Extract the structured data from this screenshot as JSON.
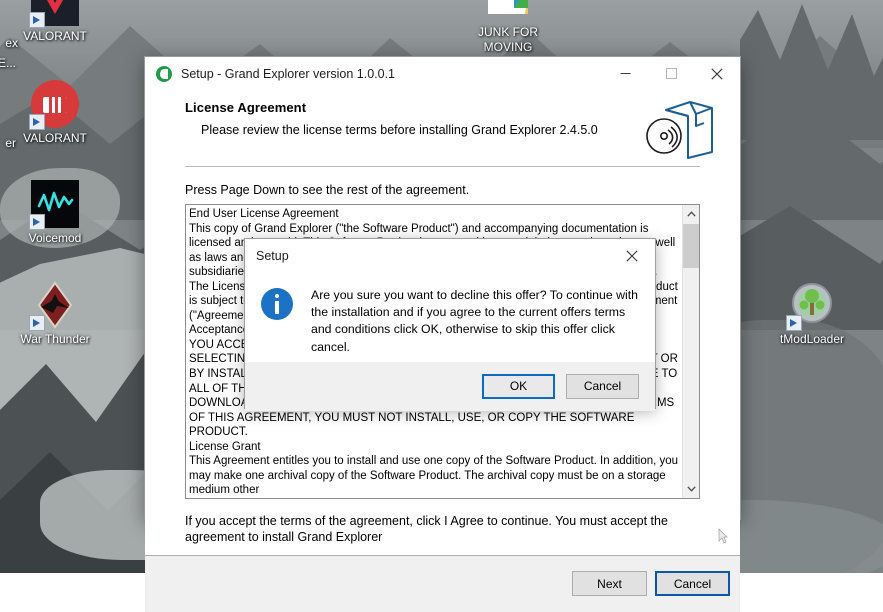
{
  "desktop": {
    "icons": [
      {
        "label": "VALORANT",
        "icon": "valorant-tile-icon",
        "shortcut": true
      },
      {
        "label": "VALORANT",
        "icon": "riot-fist-icon",
        "shortcut": true
      },
      {
        "label": "Voicemod",
        "icon": "voicemod-icon",
        "shortcut": true
      },
      {
        "label": "War Thunder",
        "icon": "war-thunder-icon",
        "shortcut": true
      },
      {
        "label": "JUNK FOR MOVING",
        "icon": "folder-icon",
        "shortcut": false
      },
      {
        "label": "tModLoader",
        "icon": "tmodloader-icon",
        "shortcut": true
      }
    ],
    "partial_labels": {
      "left_top": "ex",
      "left_top2": "E...",
      "left_mid": "er"
    }
  },
  "setup_window": {
    "title": "Setup - Grand Explorer version 1.0.0.1",
    "app_icon": "grand-explorer-icon",
    "window_controls": {
      "minimize": "minimize-icon",
      "maximize": "maximize-icon",
      "close": "close-icon"
    },
    "hero": {
      "heading": "License Agreement",
      "subheading": "Please review the license terms before installing Grand Explorer 2.4.5.0",
      "art": "software-box-cd-icon"
    },
    "page_down_hint": "Press Page Down to see the rest of the agreement.",
    "license_text": "End User License Agreement\nThis copy of Grand Explorer (\"the Software Product\") and accompanying documentation is licensed and not sold. This Software Product is protected by copyright laws and treaties, as well as laws and treaties related to other forms of intellectual property. Grand Explorer or its subsidiaries, affiliates, and suppliers own intellectual property rights in the Software Product. The Licensee's (\"you\" or \"your\") license to download, use, copy, or change the Software Product is subject to these rights and to all the terms and conditions of this End User License Agreement (\"Agreement\").\nAcceptance\nYOU ACCEPT AND AGREE TO BE BOUND BY THE TERMS OF THIS AGREEMENT BY SELECTING THE \"ACCEPT\" OPTION AND DOWNLOADING THE SOFTWARE PRODUCT OR BY INSTALLING, USING, OR COPYING THE SOFTWARE PRODUCT. YOU MUST AGREE TO ALL OF THE TERMS OF THIS AGREEMENT BEFORE YOU WILL BE ALLOWED TO DOWNLOAD THE SOFTWARE PRODUCT. IF YOU DO NOT AGREE TO ALL OF THE TERMS OF THIS AGREEMENT, YOU MUST NOT INSTALL, USE, OR COPY THE SOFTWARE PRODUCT.\nLicense Grant\nThis Agreement entitles you to install and use one copy of the Software Product. In addition, you may make one archival copy of the Software Product. The archival copy must be on a storage medium other",
    "scrollbar": {
      "up_arrow": "chevron-up-icon",
      "down_arrow": "chevron-down-icon"
    },
    "accept_note": "If you accept the terms of the agreement, click I Agree to continue. You must accept the agreement to install Grand Explorer",
    "buttons": {
      "next": "Next",
      "cancel": "Cancel"
    }
  },
  "modal": {
    "title": "Setup",
    "close_icon": "close-icon",
    "info_icon": "info-icon",
    "message": "Are you sure you want to decline this offer? To continue with the installation and if you agree to the current offers terms and conditions click OK, otherwise to skip this offer click cancel.",
    "buttons": {
      "ok": "OK",
      "cancel": "Cancel"
    }
  },
  "colors": {
    "accent_blue": "#0a6cc4",
    "info_blue": "#1c72c4",
    "footer_gray": "#f0f0f0",
    "button_gray": "#e1e1e1",
    "focus_border": "#0a56a8"
  }
}
